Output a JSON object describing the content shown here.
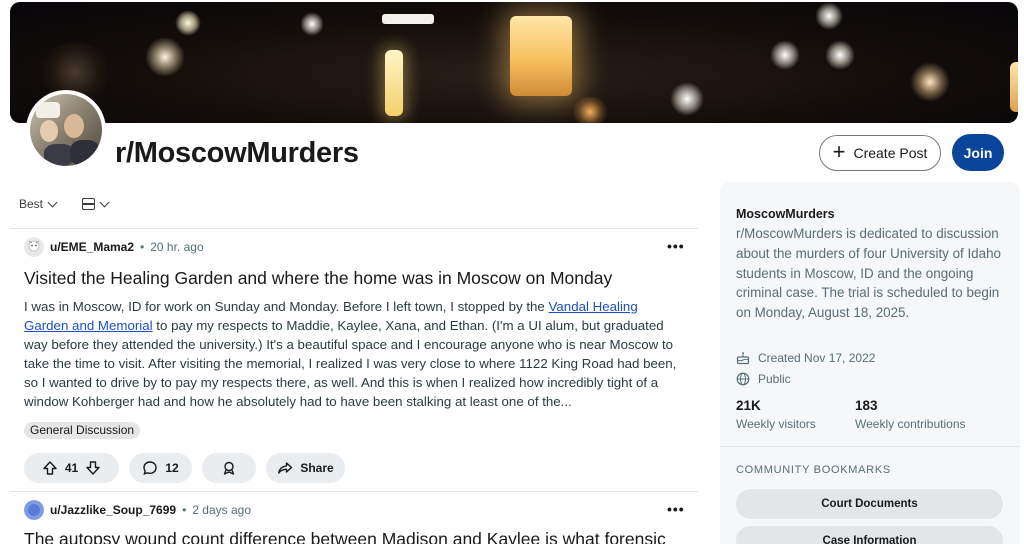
{
  "subreddit": {
    "name": "r/MoscowMurders",
    "create_post_label": "Create Post",
    "join_label": "Join"
  },
  "sort": {
    "label": "Best"
  },
  "posts": [
    {
      "user": "u/EME_Mama2",
      "time": "20 hr. ago",
      "title": "Visited the Healing Garden and where the home was in Moscow on Monday",
      "body_before_link": "I was in Moscow, ID for work on Sunday and Monday. Before I left town, I stopped by the ",
      "link_text": "Vandal Healing Garden and Memorial",
      "body_after_link": " to pay my respects to Maddie, Kaylee, Xana, and Ethan. (I'm a UI alum, but graduated way before they attended the university.) It's a beautiful space and I encourage anyone who is near Moscow to take the time to visit. After visiting the memorial, I realized I was very close to where 1122 King Road had been, so I wanted to drive by to pay my respects there, as well. And this is when I realized how incredibly tight of a window Kohberger had and how he absolutely had to have been stalking at least one of the...",
      "flair": "General Discussion",
      "votes": "41",
      "comments": "12",
      "share_label": "Share"
    },
    {
      "user": "u/Jazzlike_Soup_7699",
      "time": "2 days ago",
      "title": "The autopsy wound count difference between Madison and Kaylee is what forensic"
    }
  ],
  "sidebar": {
    "name": "MoscowMurders",
    "description": "r/MoscowMurders is dedicated to discussion about the murders of four University of Idaho students in Moscow, ID and the ongoing criminal case. The trial is scheduled to begin on Monday, August 18, 2025.",
    "created": "Created Nov 17, 2022",
    "visibility": "Public",
    "stats": [
      {
        "value": "21K",
        "label": "Weekly visitors"
      },
      {
        "value": "183",
        "label": "Weekly contributions"
      }
    ],
    "bookmarks_heading": "COMMUNITY BOOKMARKS",
    "bookmarks": [
      "Court Documents",
      "Case Information"
    ]
  },
  "colors": {
    "join_button": "#0a449b",
    "link": "#1d4fc4"
  }
}
